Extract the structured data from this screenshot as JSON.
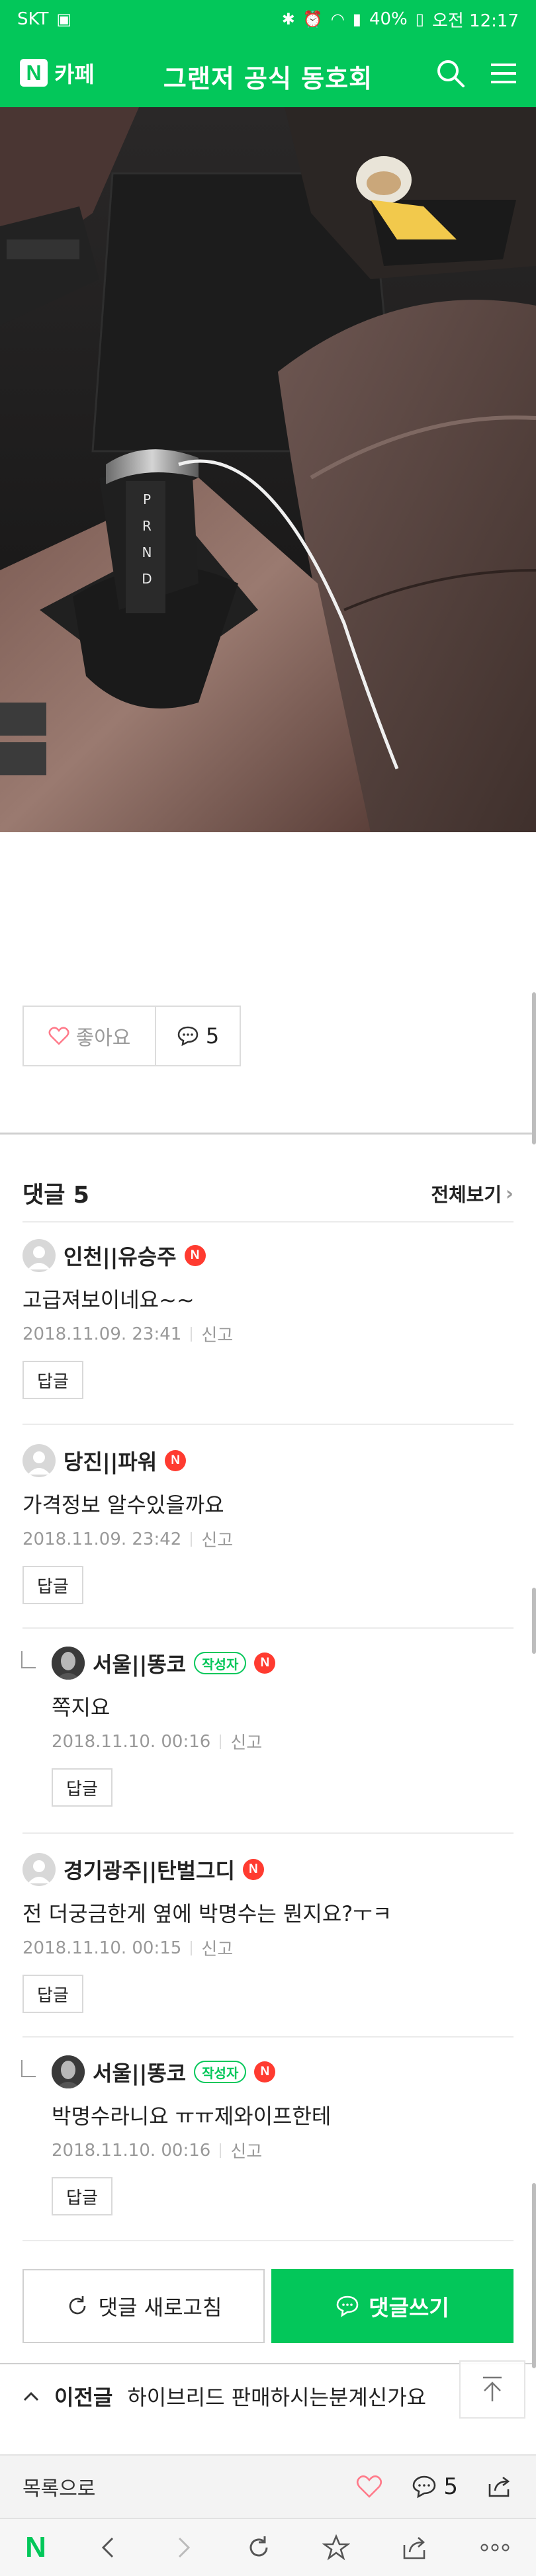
{
  "status_bar": {
    "carrier": "SKT",
    "battery": "40%",
    "time": "오전 12:17"
  },
  "header": {
    "logo_letter": "N",
    "logo_label": "카페",
    "title": "그랜저 공식 동호회",
    "icons": [
      "search-icon",
      "menu-icon"
    ]
  },
  "post_actions": {
    "like_label": "좋아요",
    "comment_count": "5"
  },
  "comments_section": {
    "title": "댓글 5",
    "view_all": "전체보기",
    "report_label": "신고",
    "reply_label": "답글",
    "writer_badge": "작성자",
    "n_badge": "N",
    "items": [
      {
        "author": "인천||유승주",
        "text": "고급져보이네요~~",
        "date": "2018.11.09. 23:41",
        "is_reply": false,
        "is_writer": false
      },
      {
        "author": "당진||파워",
        "text": "가격정보 알수있을까요",
        "date": "2018.11.09. 23:42",
        "is_reply": false,
        "is_writer": false
      },
      {
        "author": "서울||똥코",
        "text": "쪽지요",
        "date": "2018.11.10. 00:16",
        "is_reply": true,
        "is_writer": true
      },
      {
        "author": "경기광주||탄벌그디",
        "text": "전 더궁금한게 옆에 박명수는 뭔지요?ㅜㅋ",
        "date": "2018.11.10. 00:15",
        "is_reply": false,
        "is_writer": false
      },
      {
        "author": "서울||똥코",
        "text": "박명수라니요 ㅠㅠ제와이프한테",
        "date": "2018.11.10. 00:16",
        "is_reply": true,
        "is_writer": true
      }
    ]
  },
  "bottom_actions": {
    "refresh_label": "댓글 새로고침",
    "write_label": "댓글쓰기"
  },
  "prev_post": {
    "label": "이전글",
    "title": "하이브리드 판매하시는분계신가요"
  },
  "footer": {
    "list_label": "목록으로",
    "comment_count": "5"
  },
  "browser_nav": {
    "icons": [
      "naver-home-icon",
      "back-icon",
      "forward-icon",
      "refresh-icon",
      "bookmark-star-icon",
      "share-icon",
      "more-icon"
    ]
  },
  "colors": {
    "brand_green": "#03c75a",
    "badge_red": "#ff3b30",
    "meta_gray": "#999999"
  }
}
